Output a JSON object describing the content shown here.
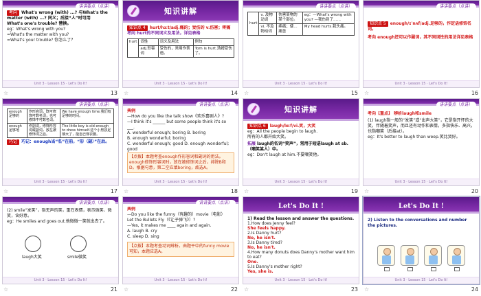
{
  "badge": "讲讲要点（点讲）",
  "footer": "Unit 3 · Lesson 15 · Let's Do It!",
  "star": "☆",
  "slides": [
    {
      "num": "13",
      "tag": "考向",
      "lines": [
        "What's wrong (with) ...? 与What's the",
        "matter (with) ...? 同义；后接“人”时可用",
        "What's one's trouble? 替换。",
        "eg：What's wrong with you?",
        "    =What's the matter with you?",
        "    =What's your trouble? 你怎么了？"
      ]
    },
    {
      "num": "14",
      "title": "知识讲解",
      "point": "知识点 4",
      "head": "hurt/hɜːt/adj.痛的；受伤的 v.伤害；疼痛",
      "sub": "考向  hurt的不同词义及用法，详见表格",
      "table": [
        [
          "词性",
          "词义及用法",
          "例句"
        ],
        [
          "adj.形容词",
          "受伤的，常用作表语。",
          "Tom is hurt.汤姆受伤了。"
        ]
      ],
      "rowlabel": "hurt"
    },
    {
      "num": "15",
      "table": [
        [
          "v. 及物动词",
          "伤害某物的某个部位。",
          "eg：—What's wrong with you?  —我伤到了……"
        ],
        [
          "vi. 不及物动词",
          "疼痛；使…痛苦",
          "My head hurts.我头痛。"
        ]
      ],
      "rowlabel": "hurt"
    },
    {
      "num": "16",
      "point": "知识点 5",
      "head": "enough/ɪˈnʌf/adj.足够的，作定语修饰名词。",
      "sub": "考向  enough还可以作副词，其不同词性的用法详见表格"
    },
    {
      "num": "17",
      "table": [
        [
          "enough 足够的",
          "作形容词，既可修饰可数名词，也可修饰不可数名词。",
          "We have enough time.我们有足够的时间。"
        ],
        [
          "enough 足够地",
          "作副词，修饰形容词或副词，放在被修饰词之后。",
          "The little boy is old enough to dress himself.这个小男孩足够大了，能自己穿衣服。"
        ]
      ],
      "note": "巧记：enough当“名”在前，“形（副）”在后。",
      "notelabel": "巧记"
    },
    {
      "num": "18",
      "label": "典例",
      "lines": [
        "—How do you like the talk show《欢乐喜剧人》?",
        "—I think it's ______ but some people think it's so ___.",
        "A. wonderful enough; boring  B. boring",
        "B. enough wonderful; boring",
        "C. wonderful enough; good  D. enough wonderful; good"
      ],
      "note": "【点拨】本题考查enough作形容词和副词的用法。enough修饰形容词时，放在被修饰词之后，排除B和D。根据句意，第二空应填boring，故选A。"
    },
    {
      "num": "19",
      "title": "知识讲解",
      "point": "知识点 6",
      "head": "laugh/lɑːf/vi.笑，大笑",
      "lines": [
        "eg：All the people begin to laugh.",
        "    所有的人都开始大笑。"
      ],
      "ext": "拓展",
      "exthead": "laugh的名词“笑声”，常用于短语laugh at sb.（嘲笑某人）中。",
      "extlines": [
        "eg：Don't laugh at him.不要嘲笑他。"
      ]
    },
    {
      "num": "20",
      "head": "考向【重点】 辨析laugh和smile",
      "lines": [
        "(1) laugh指一般的“发笑”或“出声大笑”，它是指开怀的大笑，伴随着笑声，而且还有动作和表情，多指快乐、高兴，也指嘲笑（后接at）。",
        "eg：It's better to laugh than weep.笑比哭好。"
      ]
    },
    {
      "num": "21",
      "lines": [
        "(2) smile“发笑”，指无声的笑，重在表情，表示微笑、微笑，含好意。",
        "eg：He smiles and goes out.他微微一笑就出去了。"
      ],
      "cap1": "laugh大笑",
      "cap2": "smile微笑"
    },
    {
      "num": "22",
      "label": "典例",
      "lines": [
        "—Do you like the funny（有趣的）movie（电影）",
        "  Let the Bullets Fly（《让子弹飞》）?",
        "—Yes, it makes me ____ again and again.",
        "A. laugh        B. cry",
        "C. sleep        D. sing"
      ],
      "note": "【点拨】本题考查动词辨析。由题干中的funny movie 可知，本题应选A。"
    },
    {
      "num": "23",
      "title": "Let's Do It !",
      "head": "1) Read the lesson and answer the questions.",
      "qa": [
        [
          "1.How does Jenny feel?",
          "She feels happy."
        ],
        [
          "2.Is Danny hurt?",
          "No, he isn't."
        ],
        [
          "3.Is Danny tired?",
          "No, he isn't."
        ],
        [
          "4.How many donuts does Danny's mother want him to eat?",
          "One."
        ],
        [
          "5.Is Danny's mother right?",
          "Yes, she is."
        ]
      ]
    },
    {
      "num": "24",
      "title": "Let's Do It !",
      "head": "2) Listen to the conversations and number the pictures."
    }
  ]
}
